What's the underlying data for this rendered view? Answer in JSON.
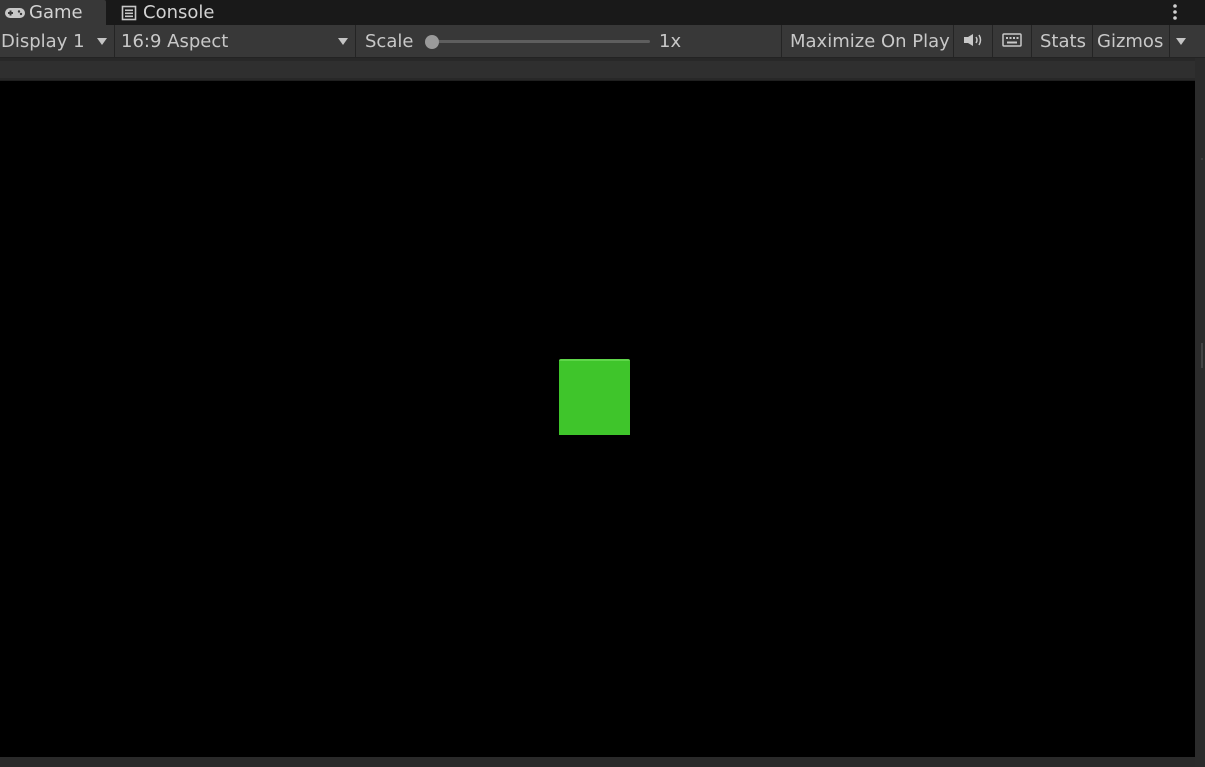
{
  "tabs": [
    {
      "label": "Game",
      "icon": "gamepad-icon",
      "active": true
    },
    {
      "label": "Console",
      "icon": "console-icon",
      "active": false
    }
  ],
  "toolbar": {
    "display": "Display 1",
    "aspect": "16:9 Aspect",
    "scale_label": "Scale",
    "scale_value": "1x",
    "scale_fraction": 0.0,
    "maximize": "Maximize On Play",
    "mute_icon": "speaker-icon",
    "keyboard_icon": "keyboard-icon",
    "stats": "Stats",
    "gizmos": "Gizmos"
  },
  "scene": {
    "background_color": "#000000",
    "cube_color": "#3fc52b"
  }
}
